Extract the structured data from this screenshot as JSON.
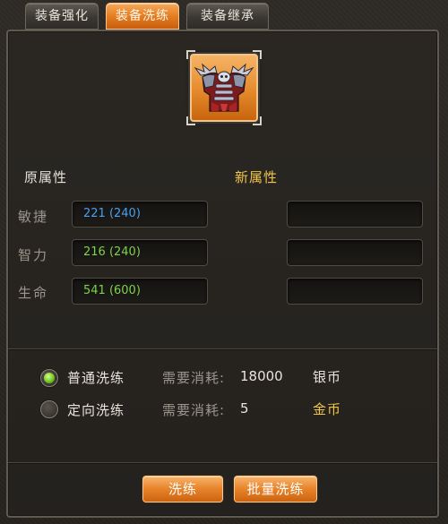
{
  "tabs": [
    {
      "label": "装备强化",
      "active": false
    },
    {
      "label": "装备洗练",
      "active": true
    },
    {
      "label": "装备继承",
      "active": false
    }
  ],
  "item": {
    "icon": "armor-icon",
    "slot_color": "#e58a2c"
  },
  "headers": {
    "old": "原属性",
    "new": "新属性"
  },
  "stats": [
    {
      "label": "敏捷",
      "old_value": "221 (240)",
      "new_value": "",
      "color": "#4a9ff0"
    },
    {
      "label": "智力",
      "old_value": "216 (240)",
      "new_value": "",
      "color": "#7ed14a"
    },
    {
      "label": "生命",
      "old_value": "541 (600)",
      "new_value": "",
      "color": "#7ed14a"
    }
  ],
  "options": [
    {
      "label": "普通洗练",
      "selected": true,
      "cost_label": "需要消耗:",
      "cost_value": "18000",
      "currency": "银币"
    },
    {
      "label": "定向洗练",
      "selected": false,
      "cost_label": "需要消耗:",
      "cost_value": "5",
      "currency": "金币"
    }
  ],
  "buttons": {
    "refine": "洗练",
    "batch_refine": "批量洗练"
  },
  "colors": {
    "accent": "#e7832a",
    "gold": "#f0c548",
    "panel": "#26231f"
  }
}
